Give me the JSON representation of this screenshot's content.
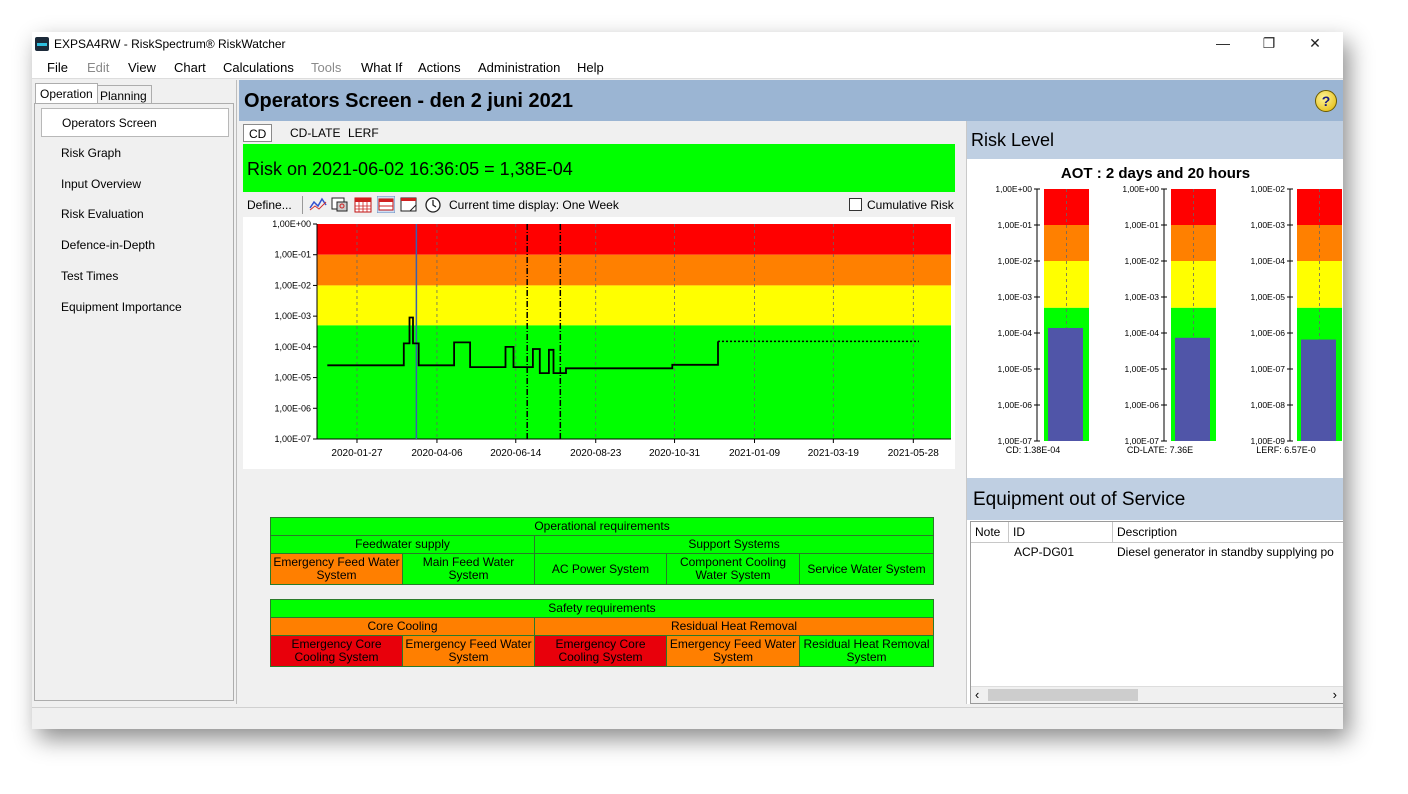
{
  "window": {
    "title": "EXPSA4RW - RiskSpectrum® RiskWatcher",
    "minimize": "—",
    "maximize": "❐",
    "close": "✕"
  },
  "menubar": [
    "File",
    "Edit",
    "View",
    "Chart",
    "Calculations",
    "Tools",
    "What If",
    "Actions",
    "Administration",
    "Help"
  ],
  "nav": {
    "tabs": [
      "Operation",
      "Planning"
    ],
    "items": [
      "Operators Screen",
      "Risk Graph",
      "Input Overview",
      "Risk Evaluation",
      "Defence-in-Depth",
      "Test Times",
      "Equipment Importance"
    ],
    "selected": "Operators Screen"
  },
  "main": {
    "title": "Operators Screen - den 2 juni 2021",
    "help_glyph": "?",
    "chart_tabs": [
      "CD",
      "CD-LATE",
      "LERF"
    ],
    "risk_banner": "Risk on 2021-06-02 16:36:05 = 1,38E-04",
    "toolbar": {
      "define": "Define...",
      "current_time": "Current time display: One Week",
      "cumulative": "Cumulative Risk",
      "icons": [
        "line-chart-icon",
        "zoom-icon",
        "calendar-icon",
        "calendar-week-icon",
        "window-icon",
        "clock-icon"
      ]
    }
  },
  "colors": {
    "red": "#ff0000",
    "orange": "#ff8000",
    "yellow": "#ffff00",
    "green": "#00ff00",
    "bar": "#5055a8"
  },
  "chart_data": {
    "type": "line",
    "y_scale": "log",
    "yticks": [
      "1,00E+00",
      "1,00E-01",
      "1,00E-02",
      "1,00E-03",
      "1,00E-04",
      "1,00E-05",
      "1,00E-06",
      "1,00E-07"
    ],
    "xticks": [
      "2020-01-27",
      "2020-04-06",
      "2020-06-14",
      "2020-08-23",
      "2020-10-31",
      "2021-01-09",
      "2021-03-19",
      "2021-05-28"
    ],
    "x_range": [
      "2019-12-23",
      "2021-06-30"
    ],
    "y_range": [
      1e-07,
      1
    ],
    "bands": [
      {
        "color": "#ff0000",
        "from": 0.1,
        "to": 1
      },
      {
        "color": "#ff8000",
        "from": 0.01,
        "to": 0.1
      },
      {
        "color": "#ffff00",
        "from": 0.0005,
        "to": 0.01
      },
      {
        "color": "#00ff00",
        "from": 1e-07,
        "to": 0.0005
      }
    ],
    "series": [
      {
        "x": [
          "2020-01-01",
          "2020-03-08",
          "2020-03-08",
          "2020-03-13",
          "2020-03-13",
          "2020-03-16",
          "2020-03-16",
          "2020-03-21",
          "2020-03-21",
          "2020-04-21",
          "2020-04-21",
          "2020-05-05",
          "2020-05-05",
          "2020-06-05",
          "2020-06-05",
          "2020-06-12",
          "2020-06-12",
          "2020-06-29",
          "2020-06-29",
          "2020-07-05",
          "2020-07-05",
          "2020-07-13",
          "2020-07-13",
          "2020-07-17",
          "2020-07-17",
          "2020-07-28",
          "2020-07-28",
          "2020-10-29",
          "2020-10-29",
          "2020-12-08",
          "2020-12-08"
        ],
        "y": [
          2.5e-05,
          2.5e-05,
          0.00013,
          0.00013,
          0.0009,
          0.0009,
          0.00013,
          0.00013,
          2.5e-05,
          2.5e-05,
          0.00014,
          0.00014,
          2.2e-05,
          2.2e-05,
          0.0001,
          0.0001,
          2.2e-05,
          2.2e-05,
          8.5e-05,
          8.5e-05,
          1.4e-05,
          1.4e-05,
          8e-05,
          8e-05,
          1.4e-05,
          1.4e-05,
          2e-05,
          2e-05,
          2.6e-05,
          2.6e-05,
          0.00015
        ]
      },
      {
        "x": [
          "2020-12-08",
          "2021-06-02"
        ],
        "y": [
          0.00015,
          0.00015
        ]
      }
    ],
    "markers": [
      {
        "x": "2020-03-19",
        "style": "now-line"
      },
      {
        "x": "2020-06-24",
        "style": "dash-dot"
      },
      {
        "x": "2020-07-23",
        "style": "dash-dot"
      }
    ]
  },
  "requirements": {
    "operational": {
      "title": "Operational requirements",
      "groups": [
        {
          "title": "Feedwater supply",
          "systems": [
            {
              "label": "Emergency Feed Water System",
              "status": "orange"
            },
            {
              "label": "Main Feed Water System",
              "status": "green"
            }
          ]
        },
        {
          "title": "Support Systems",
          "systems": [
            {
              "label": "AC Power System",
              "status": "green"
            },
            {
              "label": "Component Cooling Water System",
              "status": "green"
            },
            {
              "label": "Service Water System",
              "status": "green"
            }
          ]
        }
      ]
    },
    "safety": {
      "title": "Safety requirements",
      "groups": [
        {
          "title": "Core Cooling",
          "systems": [
            {
              "label": "Emergency Core Cooling System",
              "status": "red"
            },
            {
              "label": "Emergency Feed Water System",
              "status": "orange"
            }
          ]
        },
        {
          "title": "Residual Heat Removal",
          "systems": [
            {
              "label": "Emergency Core Cooling System",
              "status": "red"
            },
            {
              "label": "Emergency Feed Water System",
              "status": "orange"
            },
            {
              "label": "Residual Heat Removal System",
              "status": "green"
            }
          ]
        }
      ]
    }
  },
  "risk_level": {
    "title": "Risk Level",
    "aot": "AOT : 2 days and 20 hours",
    "gauges": [
      {
        "label": "CD: 1,38E-04",
        "value": 0.000138,
        "yticks": [
          "1,00E+00",
          "1,00E-01",
          "1,00E-02",
          "1,00E-03",
          "1,00E-04",
          "1,00E-05",
          "1,00E-06",
          "1,00E-07"
        ],
        "y_range": [
          1e-07,
          1
        ],
        "bands": [
          0.1,
          0.01,
          0.0005
        ]
      },
      {
        "label": "CD-LATE: 7,36E",
        "value": 7.36e-05,
        "yticks": [
          "1,00E+00",
          "1,00E-01",
          "1,00E-02",
          "1,00E-03",
          "1,00E-04",
          "1,00E-05",
          "1,00E-06",
          "1,00E-07"
        ],
        "y_range": [
          1e-07,
          1
        ],
        "bands": [
          0.1,
          0.01,
          0.0005
        ]
      },
      {
        "label": "LERF: 6,57E-0",
        "value": 6.57e-07,
        "yticks": [
          "1,00E-02",
          "1,00E-03",
          "1,00E-04",
          "1,00E-05",
          "1,00E-06",
          "1,00E-07",
          "1,00E-08",
          "1,00E-09"
        ],
        "y_range": [
          1e-09,
          0.01
        ],
        "bands": [
          0.001,
          0.0001,
          5e-06
        ]
      }
    ]
  },
  "equipment": {
    "title": "Equipment out of Service",
    "columns": [
      "Note",
      "ID",
      "Description"
    ],
    "rows": [
      {
        "note": "",
        "id": "ACP-DG01",
        "description": "Diesel generator in standby supplying po"
      }
    ],
    "scroll_left": "‹",
    "scroll_right": "›"
  }
}
